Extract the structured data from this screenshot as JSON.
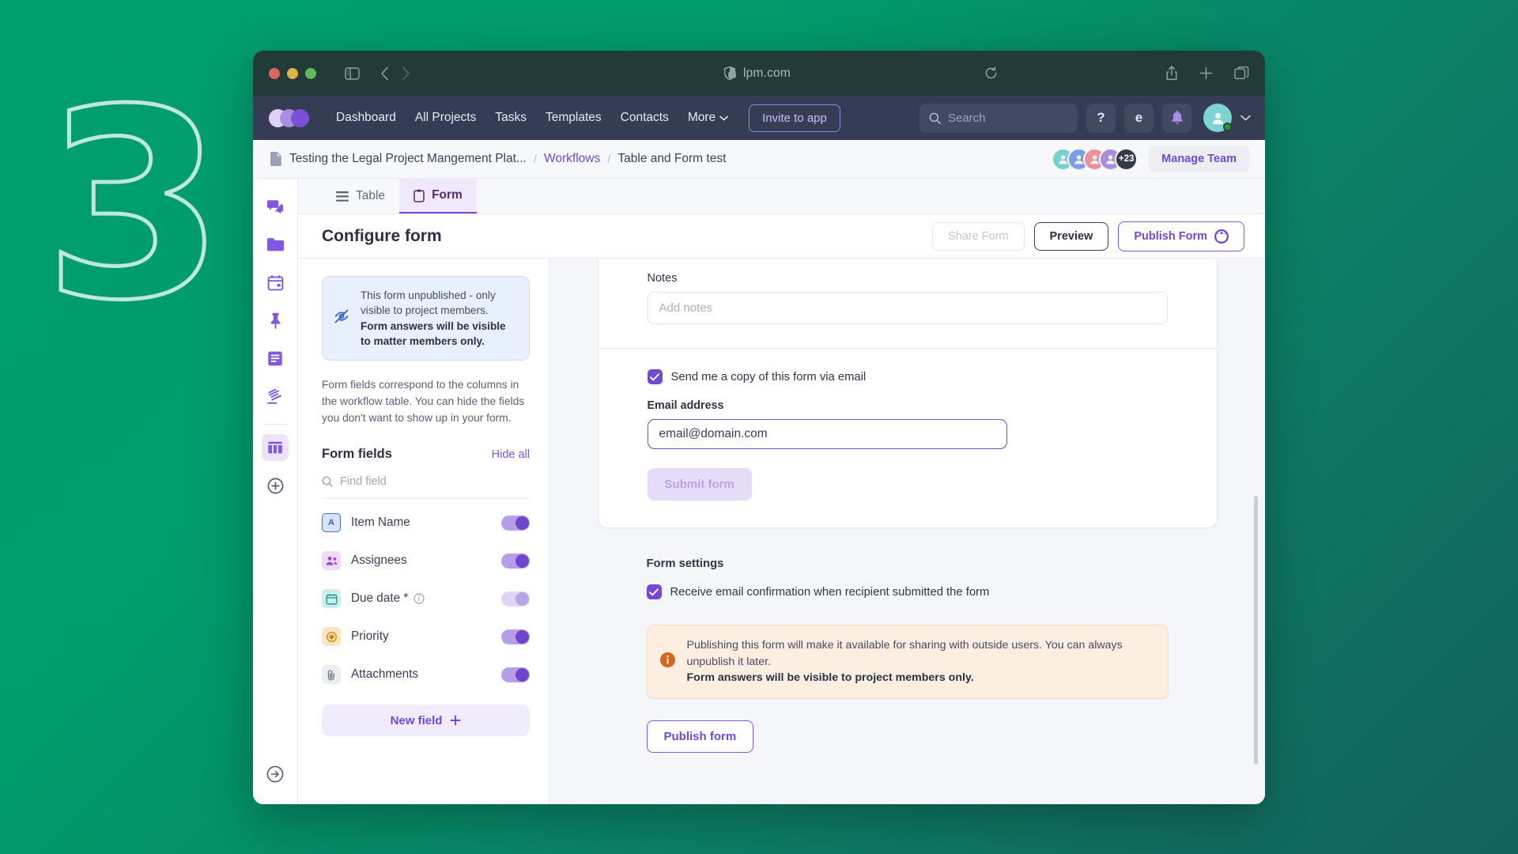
{
  "background": {
    "numeral": "3",
    "color": "#00996b"
  },
  "browser": {
    "url": "lpm.com",
    "lock_icon": "lock-icon",
    "sidebar_icon": "sidebar-toggle-icon",
    "back_icon": "back-arrow-icon",
    "forward_icon": "forward-arrow-icon",
    "shield_icon": "shield-icon",
    "reload_icon": "reload-icon",
    "share_icon": "share-icon",
    "new_tab_icon": "plus-icon",
    "tabs_icon": "tab-overview-icon"
  },
  "appnav": {
    "logo": "app-logo",
    "links": [
      {
        "label": "Dashboard"
      },
      {
        "label": "All Projects"
      },
      {
        "label": "Tasks"
      },
      {
        "label": "Templates"
      },
      {
        "label": "Contacts"
      },
      {
        "label": "More",
        "has_chevron": true
      }
    ],
    "invite_label": "Invite to app",
    "search_placeholder": "Search",
    "help_label": "?",
    "extension_label": "e",
    "bell_icon": "bell-icon",
    "avatar_chevron": "chevron-down-icon"
  },
  "breadcrumb": {
    "doc_icon": "document-icon",
    "items": [
      {
        "label": "Testing the Legal Project Mangement Plat...",
        "link": false
      },
      {
        "label": "Workflows",
        "link": true
      },
      {
        "label": "Table and Form test",
        "link": false
      }
    ],
    "separator": "/",
    "avatars": [
      "#76d2d0",
      "#7d9de8",
      "#ef8f9c",
      "#a98ee0"
    ],
    "more_count": "+23",
    "manage_team_label": "Manage Team"
  },
  "rail": {
    "items": [
      {
        "name": "chat-icon",
        "active": false
      },
      {
        "name": "folder-icon",
        "active": false
      },
      {
        "name": "calendar-icon",
        "active": false
      },
      {
        "name": "pin-icon",
        "active": false
      },
      {
        "name": "notes-icon",
        "active": false
      },
      {
        "name": "gavel-icon",
        "active": false
      },
      {
        "name": "table-icon",
        "active": true
      },
      {
        "name": "add-circle-icon",
        "active": false
      }
    ],
    "bottom_icon": "expand-sidebar-icon"
  },
  "tabs": [
    {
      "label": "Table",
      "icon": "list-icon",
      "active": false
    },
    {
      "label": "Form",
      "icon": "clipboard-icon",
      "active": true
    }
  ],
  "header": {
    "title": "Configure form",
    "share_label": "Share Form",
    "preview_label": "Preview",
    "publish_label": "Publish Form",
    "publish_icon": "globe-icon"
  },
  "config_pane": {
    "notice": {
      "icon": "eye-off-icon",
      "line1": "This form unpublished - only visible to project members.",
      "line2": "Form answers will be visible to matter members only."
    },
    "description": "Form fields correspond to the columns in the workflow table. You can hide the fields you don't want to show up in your form.",
    "fields_title": "Form fields",
    "hide_all_label": "Hide all",
    "find_placeholder": "Find field",
    "find_icon": "search-icon",
    "fields": [
      {
        "label": "Item Name",
        "icon": "text-field-icon",
        "icon_class": "name",
        "glyph": "A",
        "enabled": true,
        "required": false
      },
      {
        "label": "Assignees",
        "icon": "people-icon",
        "icon_class": "people",
        "enabled": true,
        "required": false
      },
      {
        "label": "Due date *",
        "icon": "calendar-icon",
        "icon_class": "cal",
        "enabled": false,
        "required": true,
        "info_icon": "info-icon"
      },
      {
        "label": "Priority",
        "icon": "target-icon",
        "icon_class": "prio",
        "enabled": true,
        "required": false
      },
      {
        "label": "Attachments",
        "icon": "paperclip-icon",
        "icon_class": "clip",
        "enabled": true,
        "required": false
      }
    ],
    "new_field_label": "New field",
    "new_field_icon": "plus-icon"
  },
  "form_preview": {
    "notes_label": "Notes",
    "notes_placeholder": "Add notes",
    "copy_checkbox_label": "Send me a copy of this form via email",
    "copy_checked": true,
    "email_label": "Email address",
    "email_placeholder": "email@domain.com",
    "submit_label": "Submit form",
    "submit_disabled": true
  },
  "form_settings": {
    "title": "Form settings",
    "confirmation_label": "Receive email confirmation when recipient submitted the form",
    "confirmation_checked": true,
    "warning": {
      "icon": "info-circle-icon",
      "line1": "Publishing this form will make it available for sharing with outside users. You can always unpublish it later.",
      "line2": "Form answers will be visible to project members only."
    },
    "publish_label": "Publish form"
  },
  "colors": {
    "accent_purple": "#6f4ad2",
    "brand_green": "#00996b",
    "navbar_dark": "#353d54",
    "warning_orange": "#d9641b",
    "info_blue": "#2d62d0"
  }
}
